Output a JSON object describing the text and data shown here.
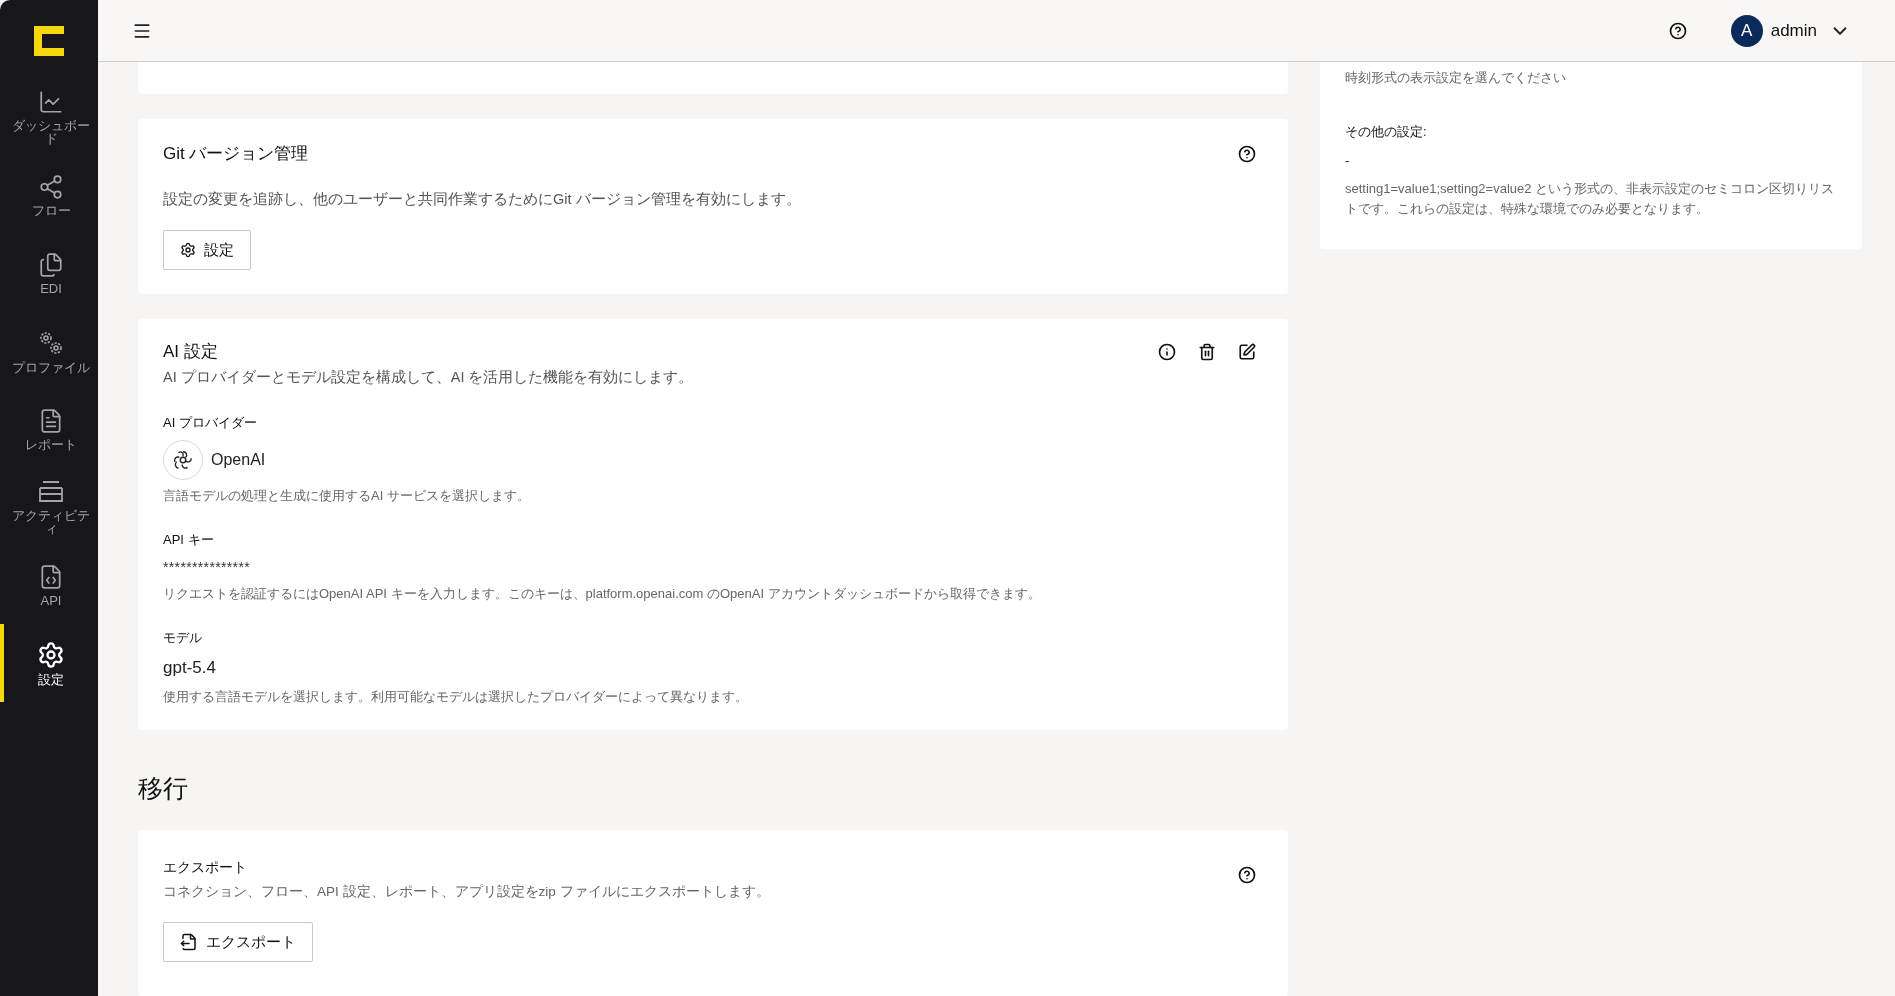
{
  "sidebar": {
    "items": [
      {
        "kind": "chart",
        "label": "ダッシュボード",
        "selected": false
      },
      {
        "kind": "share",
        "label": "フロー",
        "selected": false
      },
      {
        "kind": "files",
        "label": "EDI",
        "selected": false
      },
      {
        "kind": "gears",
        "label": "プロファイル",
        "selected": false
      },
      {
        "kind": "report",
        "label": "レポート",
        "selected": false
      },
      {
        "kind": "tray",
        "label": "アクティビティ",
        "selected": false
      },
      {
        "kind": "code",
        "label": "API",
        "selected": false
      },
      {
        "kind": "gear",
        "label": "設定",
        "selected": true
      }
    ]
  },
  "header": {
    "user": {
      "initial": "A",
      "name": "admin"
    }
  },
  "git_card": {
    "title": "Git バージョン管理",
    "description": "設定の変更を追跡し、他のユーザーと共同作業するためにGit バージョン管理を有効にします。",
    "button": "設定"
  },
  "ai_card": {
    "title": "AI 設定",
    "description": "AI プロバイダーとモデル設定を構成して、AI を活用した機能を有効にします。",
    "fields": [
      {
        "kind": "provider",
        "label": "AI プロバイダー",
        "value": "OpenAI",
        "help": "言語モデルの処理と生成に使用するAI サービスを選択します。"
      },
      {
        "kind": "secret",
        "label": "API キー",
        "value": "***************",
        "help": "リクエストを認証するにはOpenAI API キーを入力します。このキーは、platform.openai.com のOpenAI アカウントダッシュボードから取得できます。"
      },
      {
        "kind": "text",
        "label": "モデル",
        "value": "gpt-5.4",
        "help": "使用する言語モデルを選択します。利用可能なモデルは選択したプロバイダーによって異なります。"
      }
    ]
  },
  "migration": {
    "heading": "移行",
    "export_card": {
      "title": "エクスポート",
      "description": "コネクション、フロー、API 設定、レポート、アプリ設定をzip ファイルにエクスポートします。",
      "button": "エクスポート"
    }
  },
  "right_panel": {
    "time_hint": "時刻形式の表示設定を選んでください",
    "other_label": "その他の設定:",
    "other_value": "-",
    "other_help": "setting1=value1;setting2=value2 という形式の、非表示設定のセミコロン区切りリストです。これらの設定は、特殊な環境でのみ必要となります。"
  }
}
